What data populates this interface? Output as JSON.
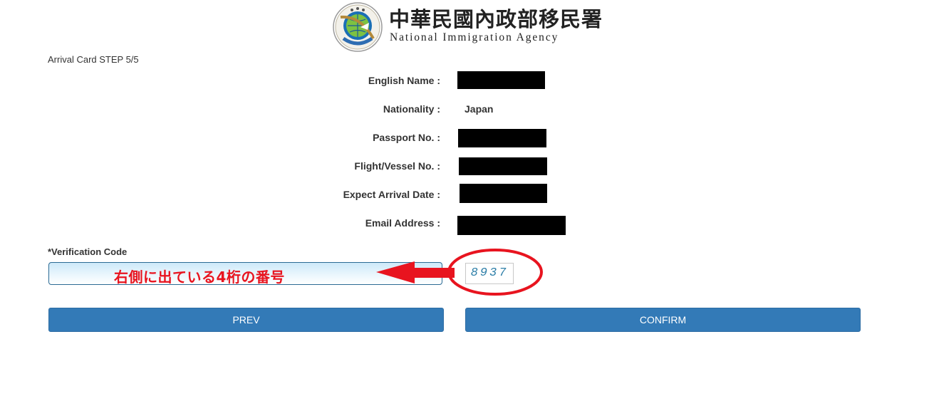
{
  "header": {
    "agency_name_cn": "中華民國內政部移民署",
    "agency_name_en": "National Immigration Agency",
    "emblem_text": "National Immigration Agency"
  },
  "page": {
    "step_label": "Arrival Card STEP 5/5"
  },
  "fields": [
    {
      "label": "English Name :",
      "value": "",
      "redacted": true
    },
    {
      "label": "Nationality :",
      "value": "Japan",
      "redacted": false
    },
    {
      "label": "Passport No. :",
      "value": "",
      "redacted": true
    },
    {
      "label": "Flight/Vessel No. :",
      "value": "",
      "redacted": true
    },
    {
      "label": "Expect Arrival Date :",
      "value": "",
      "redacted": true
    },
    {
      "label": "Email Address :",
      "value": "",
      "redacted": true
    }
  ],
  "verification": {
    "label": "*Verification Code",
    "input_value": "",
    "annotation_hint": "右側に出ている4桁の番号",
    "captcha_code": "8937",
    "annotation_color": "#e8141f"
  },
  "buttons": {
    "prev": "PREV",
    "confirm": "CONFIRM",
    "color": "#337ab7"
  }
}
